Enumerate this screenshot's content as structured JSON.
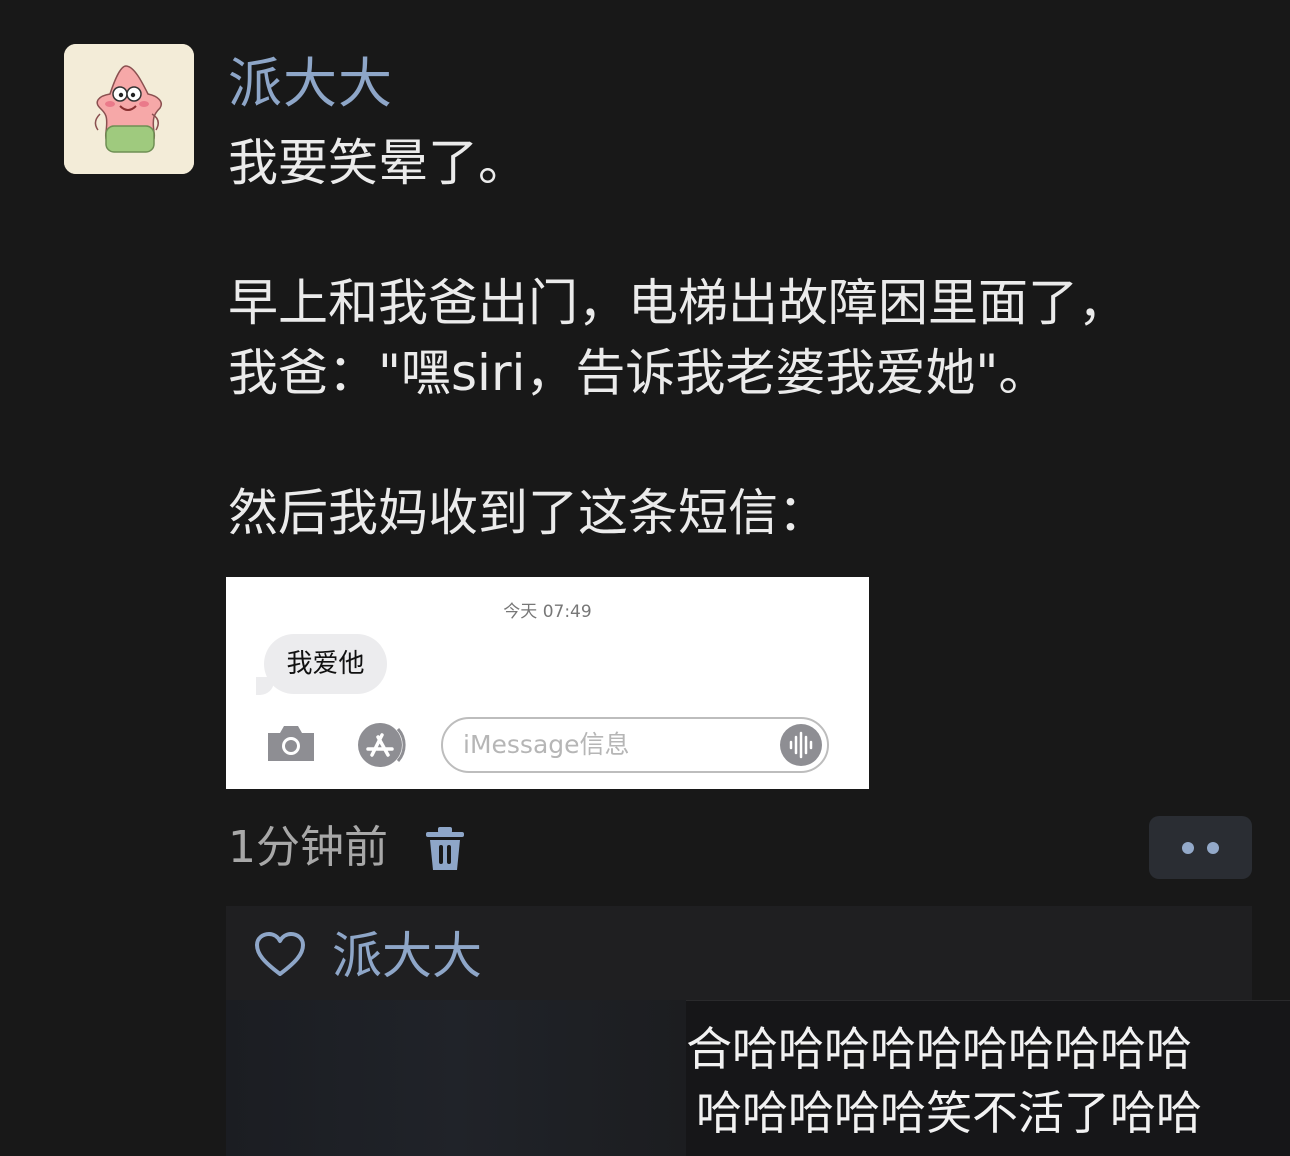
{
  "post": {
    "author": "派大大",
    "avatar_icon": "patrick-star-avatar",
    "lines": [
      "我要笑晕了。",
      "",
      "早上和我爸出门，电梯出故障困里面了，",
      "我爸：\"嘿siri，告诉我老婆我爱她\"。",
      "",
      "然后我妈收到了这条短信："
    ],
    "time_ago": "1分钟前"
  },
  "screenshot": {
    "timestamp": "今天 07:49",
    "message": "我爱他",
    "input_placeholder": "iMessage信息",
    "icons": [
      "camera-icon",
      "app-store-icon",
      "audio-waveform-icon"
    ]
  },
  "likes": {
    "names": "派大大",
    "icon": "heart-icon"
  },
  "comment": {
    "line1": "合哈哈哈哈哈哈哈哈哈哈",
    "line2": "哈哈哈哈哈笑不活了哈哈"
  },
  "colors": {
    "background": "#181818",
    "name_link": "#8ea6c8",
    "text": "#ebebeb"
  }
}
